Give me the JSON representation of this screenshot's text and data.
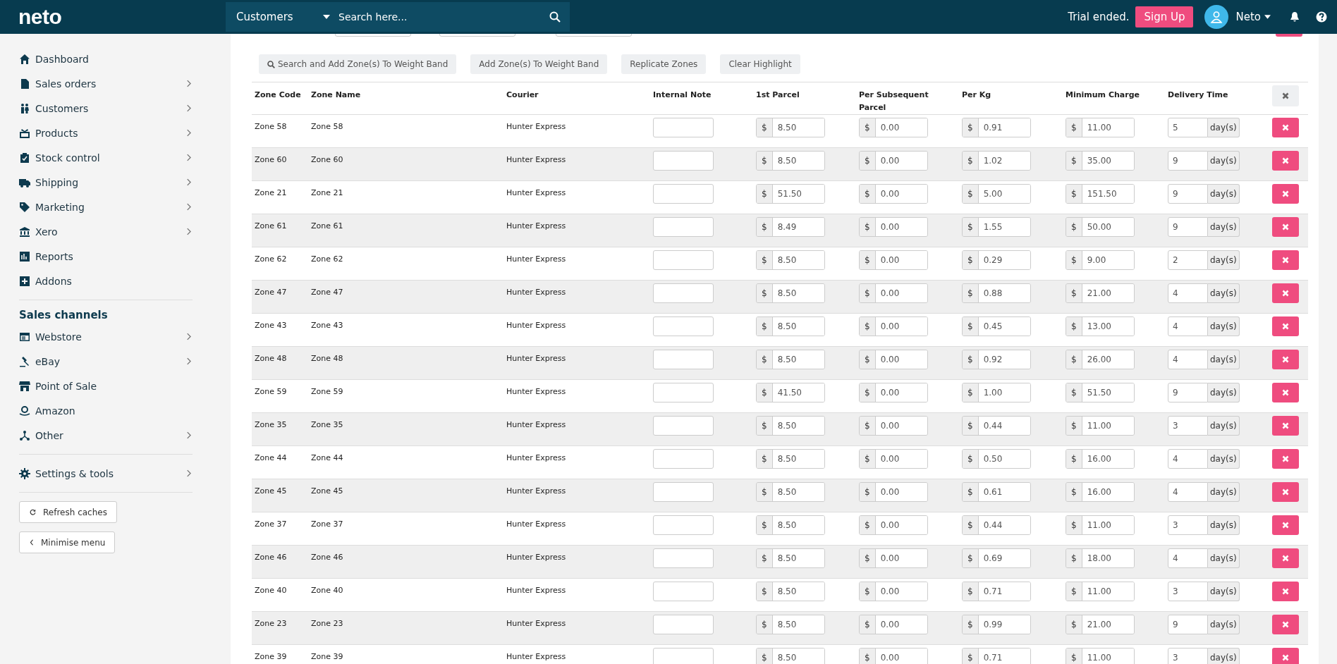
{
  "header": {
    "logo": "neto",
    "search_scope": "Customers",
    "search": {
      "placeholder": "Search here..."
    },
    "trial_status": "Trial ended.",
    "signup": "Sign Up",
    "user": "Neto"
  },
  "sidebar": {
    "items": [
      {
        "label": "Dashboard",
        "expandable": false
      },
      {
        "label": "Sales orders",
        "expandable": true
      },
      {
        "label": "Customers",
        "expandable": true
      },
      {
        "label": "Products",
        "expandable": true
      },
      {
        "label": "Stock control",
        "expandable": true
      },
      {
        "label": "Shipping",
        "expandable": true
      },
      {
        "label": "Marketing",
        "expandable": true
      },
      {
        "label": "Xero",
        "expandable": true
      },
      {
        "label": "Reports",
        "expandable": false
      },
      {
        "label": "Addons",
        "expandable": false
      }
    ],
    "section_title": "Sales channels",
    "channels": [
      {
        "label": "Webstore",
        "expandable": true
      },
      {
        "label": "eBay",
        "expandable": true
      },
      {
        "label": "Point of Sale",
        "expandable": false
      },
      {
        "label": "Amazon",
        "expandable": false
      },
      {
        "label": "Other",
        "expandable": true
      }
    ],
    "settings": [
      {
        "label": "Settings & tools",
        "expandable": true
      }
    ],
    "buttons": [
      "Refresh caches",
      "Minimise menu"
    ]
  },
  "toolbar": {
    "buttons": [
      "Search and Add Zone(s) To Weight Band",
      "Add Zone(s) To Weight Band",
      "Replicate Zones",
      "Clear Highlight"
    ]
  },
  "table": {
    "columns": [
      "Zone Code",
      "Zone Name",
      "Courier",
      "Internal Note",
      "1st Parcel",
      "Per Subsequent Parcel",
      "Per Kg",
      "Minimum Charge",
      "Delivery Time"
    ],
    "rows": [
      {
        "code": "Zone 58",
        "name": "Zone 58",
        "courier": "Hunter Express",
        "first": {
          "prefix": "$",
          "value": "8.50"
        },
        "subsequent": {
          "prefix": "$",
          "value": "0.00"
        },
        "per_kg": {
          "prefix": "$",
          "value": "0.91"
        },
        "minimum": {
          "prefix": "$",
          "value": "11.00"
        },
        "delivery": {
          "value": "5",
          "suffix": "day(s)"
        }
      },
      {
        "code": "Zone 60",
        "name": "Zone 60",
        "courier": "Hunter Express",
        "first": {
          "prefix": "$",
          "value": "8.50"
        },
        "subsequent": {
          "prefix": "$",
          "value": "0.00"
        },
        "per_kg": {
          "prefix": "$",
          "value": "1.02"
        },
        "minimum": {
          "prefix": "$",
          "value": "35.00"
        },
        "delivery": {
          "value": "9",
          "suffix": "day(s)"
        }
      },
      {
        "code": "Zone 21",
        "name": "Zone 21",
        "courier": "Hunter Express",
        "first": {
          "prefix": "$",
          "value": "51.50"
        },
        "subsequent": {
          "prefix": "$",
          "value": "0.00"
        },
        "per_kg": {
          "prefix": "$",
          "value": "5.00"
        },
        "minimum": {
          "prefix": "$",
          "value": "151.50"
        },
        "delivery": {
          "value": "9",
          "suffix": "day(s)"
        }
      },
      {
        "code": "Zone 61",
        "name": "Zone 61",
        "courier": "Hunter Express",
        "first": {
          "prefix": "$",
          "value": "8.49"
        },
        "subsequent": {
          "prefix": "$",
          "value": "0.00"
        },
        "per_kg": {
          "prefix": "$",
          "value": "1.55"
        },
        "minimum": {
          "prefix": "$",
          "value": "50.00"
        },
        "delivery": {
          "value": "9",
          "suffix": "day(s)"
        }
      },
      {
        "code": "Zone 62",
        "name": "Zone 62",
        "courier": "Hunter Express",
        "first": {
          "prefix": "$",
          "value": "8.50"
        },
        "subsequent": {
          "prefix": "$",
          "value": "0.00"
        },
        "per_kg": {
          "prefix": "$",
          "value": "0.29"
        },
        "minimum": {
          "prefix": "$",
          "value": "9.00"
        },
        "delivery": {
          "value": "2",
          "suffix": "day(s)"
        }
      },
      {
        "code": "Zone 47",
        "name": "Zone 47",
        "courier": "Hunter Express",
        "first": {
          "prefix": "$",
          "value": "8.50"
        },
        "subsequent": {
          "prefix": "$",
          "value": "0.00"
        },
        "per_kg": {
          "prefix": "$",
          "value": "0.88"
        },
        "minimum": {
          "prefix": "$",
          "value": "21.00"
        },
        "delivery": {
          "value": "4",
          "suffix": "day(s)"
        }
      },
      {
        "code": "Zone 43",
        "name": "Zone 43",
        "courier": "Hunter Express",
        "first": {
          "prefix": "$",
          "value": "8.50"
        },
        "subsequent": {
          "prefix": "$",
          "value": "0.00"
        },
        "per_kg": {
          "prefix": "$",
          "value": "0.45"
        },
        "minimum": {
          "prefix": "$",
          "value": "13.00"
        },
        "delivery": {
          "value": "4",
          "suffix": "day(s)"
        }
      },
      {
        "code": "Zone 48",
        "name": "Zone 48",
        "courier": "Hunter Express",
        "first": {
          "prefix": "$",
          "value": "8.50"
        },
        "subsequent": {
          "prefix": "$",
          "value": "0.00"
        },
        "per_kg": {
          "prefix": "$",
          "value": "0.92"
        },
        "minimum": {
          "prefix": "$",
          "value": "26.00"
        },
        "delivery": {
          "value": "4",
          "suffix": "day(s)"
        }
      },
      {
        "code": "Zone 59",
        "name": "Zone 59",
        "courier": "Hunter Express",
        "first": {
          "prefix": "$",
          "value": "41.50"
        },
        "subsequent": {
          "prefix": "$",
          "value": "0.00"
        },
        "per_kg": {
          "prefix": "$",
          "value": "1.00"
        },
        "minimum": {
          "prefix": "$",
          "value": "51.50"
        },
        "delivery": {
          "value": "9",
          "suffix": "day(s)"
        }
      },
      {
        "code": "Zone 35",
        "name": "Zone 35",
        "courier": "Hunter Express",
        "first": {
          "prefix": "$",
          "value": "8.50"
        },
        "subsequent": {
          "prefix": "$",
          "value": "0.00"
        },
        "per_kg": {
          "prefix": "$",
          "value": "0.44"
        },
        "minimum": {
          "prefix": "$",
          "value": "11.00"
        },
        "delivery": {
          "value": "3",
          "suffix": "day(s)"
        }
      },
      {
        "code": "Zone 44",
        "name": "Zone 44",
        "courier": "Hunter Express",
        "first": {
          "prefix": "$",
          "value": "8.50"
        },
        "subsequent": {
          "prefix": "$",
          "value": "0.00"
        },
        "per_kg": {
          "prefix": "$",
          "value": "0.50"
        },
        "minimum": {
          "prefix": "$",
          "value": "16.00"
        },
        "delivery": {
          "value": "4",
          "suffix": "day(s)"
        }
      },
      {
        "code": "Zone 45",
        "name": "Zone 45",
        "courier": "Hunter Express",
        "first": {
          "prefix": "$",
          "value": "8.50"
        },
        "subsequent": {
          "prefix": "$",
          "value": "0.00"
        },
        "per_kg": {
          "prefix": "$",
          "value": "0.61"
        },
        "minimum": {
          "prefix": "$",
          "value": "16.00"
        },
        "delivery": {
          "value": "4",
          "suffix": "day(s)"
        }
      },
      {
        "code": "Zone 37",
        "name": "Zone 37",
        "courier": "Hunter Express",
        "first": {
          "prefix": "$",
          "value": "8.50"
        },
        "subsequent": {
          "prefix": "$",
          "value": "0.00"
        },
        "per_kg": {
          "prefix": "$",
          "value": "0.44"
        },
        "minimum": {
          "prefix": "$",
          "value": "11.00"
        },
        "delivery": {
          "value": "3",
          "suffix": "day(s)"
        }
      },
      {
        "code": "Zone 46",
        "name": "Zone 46",
        "courier": "Hunter Express",
        "first": {
          "prefix": "$",
          "value": "8.50"
        },
        "subsequent": {
          "prefix": "$",
          "value": "0.00"
        },
        "per_kg": {
          "prefix": "$",
          "value": "0.69"
        },
        "minimum": {
          "prefix": "$",
          "value": "18.00"
        },
        "delivery": {
          "value": "4",
          "suffix": "day(s)"
        }
      },
      {
        "code": "Zone 40",
        "name": "Zone 40",
        "courier": "Hunter Express",
        "first": {
          "prefix": "$",
          "value": "8.50"
        },
        "subsequent": {
          "prefix": "$",
          "value": "0.00"
        },
        "per_kg": {
          "prefix": "$",
          "value": "0.71"
        },
        "minimum": {
          "prefix": "$",
          "value": "11.00"
        },
        "delivery": {
          "value": "3",
          "suffix": "day(s)"
        }
      },
      {
        "code": "Zone 23",
        "name": "Zone 23",
        "courier": "Hunter Express",
        "first": {
          "prefix": "$",
          "value": "8.50"
        },
        "subsequent": {
          "prefix": "$",
          "value": "0.00"
        },
        "per_kg": {
          "prefix": "$",
          "value": "0.99"
        },
        "minimum": {
          "prefix": "$",
          "value": "21.00"
        },
        "delivery": {
          "value": "9",
          "suffix": "day(s)"
        }
      },
      {
        "code": "Zone 39",
        "name": "Zone 39",
        "courier": "Hunter Express",
        "first": {
          "prefix": "$",
          "value": "8.50"
        },
        "subsequent": {
          "prefix": "$",
          "value": "0.00"
        },
        "per_kg": {
          "prefix": "$",
          "value": "0.71"
        },
        "minimum": {
          "prefix": "$",
          "value": "11.00"
        },
        "delivery": {
          "value": "3",
          "suffix": "day(s)"
        }
      }
    ]
  }
}
